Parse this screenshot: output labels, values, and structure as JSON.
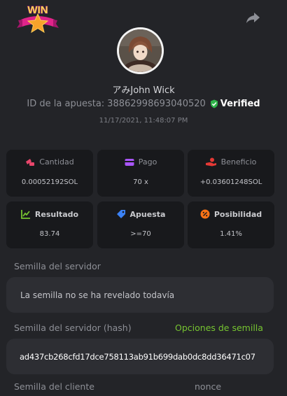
{
  "header": {
    "badge_text": "WIN",
    "username": "アみJohn Wick",
    "bet_id_label": "ID de la apuesta:",
    "bet_id": "38862998693040520",
    "verified_label": "Verified",
    "timestamp": "11/17/2021, 11:48:07 PM"
  },
  "stats": [
    {
      "label": "Cantidad",
      "value": "0.00052192SOL",
      "icon": "bet-amount-icon",
      "color": "#e8466b"
    },
    {
      "label": "Pago",
      "value": "70 x",
      "icon": "wallet-icon",
      "color": "#a855f7"
    },
    {
      "label": "Beneficio",
      "value": "+0.03601248SOL",
      "icon": "profit-hand-icon",
      "color": "#e53935"
    },
    {
      "label": "Resultado",
      "value": "83.74",
      "icon": "chart-icon",
      "color": "#76c431"
    },
    {
      "label": "Apuesta",
      "value": ">=70",
      "icon": "tag-icon",
      "color": "#3b82f6"
    },
    {
      "label": "Posibilidad",
      "value": "1.41%",
      "icon": "percent-icon",
      "color": "#f97316"
    }
  ],
  "server_seed": {
    "label": "Semilla del servidor",
    "value": "La semilla no se ha revelado todavía"
  },
  "server_seed_hash": {
    "label": "Semilla del servidor (hash)",
    "options_link": "Opciones de semilla",
    "value": "ad437cb268cfd17dce758113ab91b699dab0dc8dd36471c07"
  },
  "client_seed": {
    "label": "Semilla del cliente",
    "nonce_label": "nonce"
  }
}
